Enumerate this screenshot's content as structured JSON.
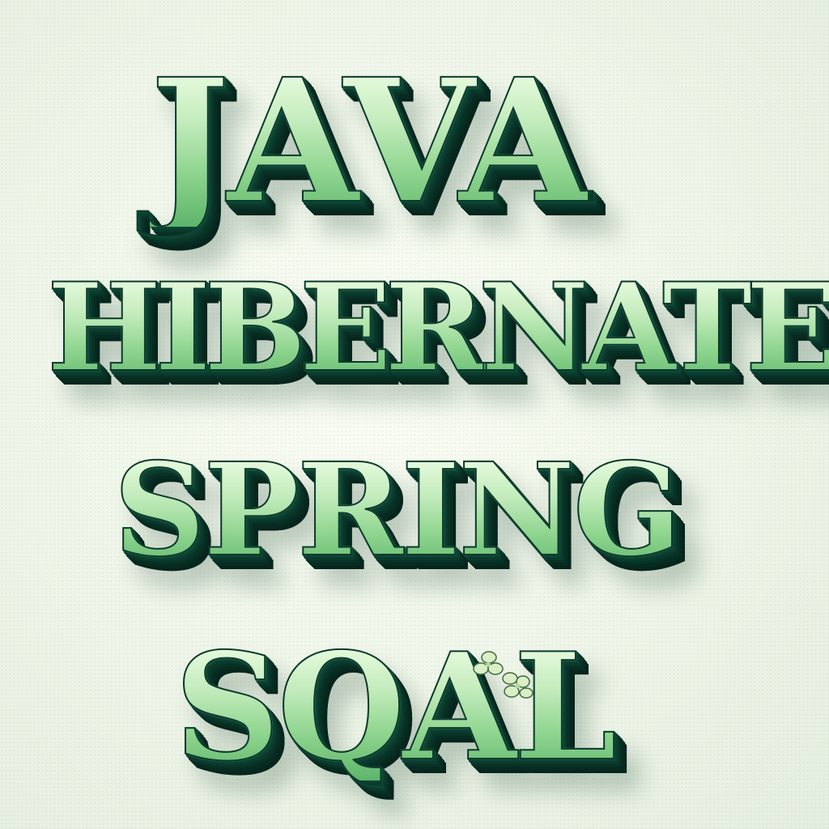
{
  "title_lines": [
    "JAVA",
    "HIBERNATE",
    "SPRING",
    "SQAL"
  ],
  "colors": {
    "letter_fill_light": "#f2ffe8",
    "letter_fill_mid": "#8fd58f",
    "letter_fill_dark": "#5eb56b",
    "extrusion": "#0b3a2c",
    "background": "#f3f8ec"
  },
  "ornament": "flower-icon"
}
